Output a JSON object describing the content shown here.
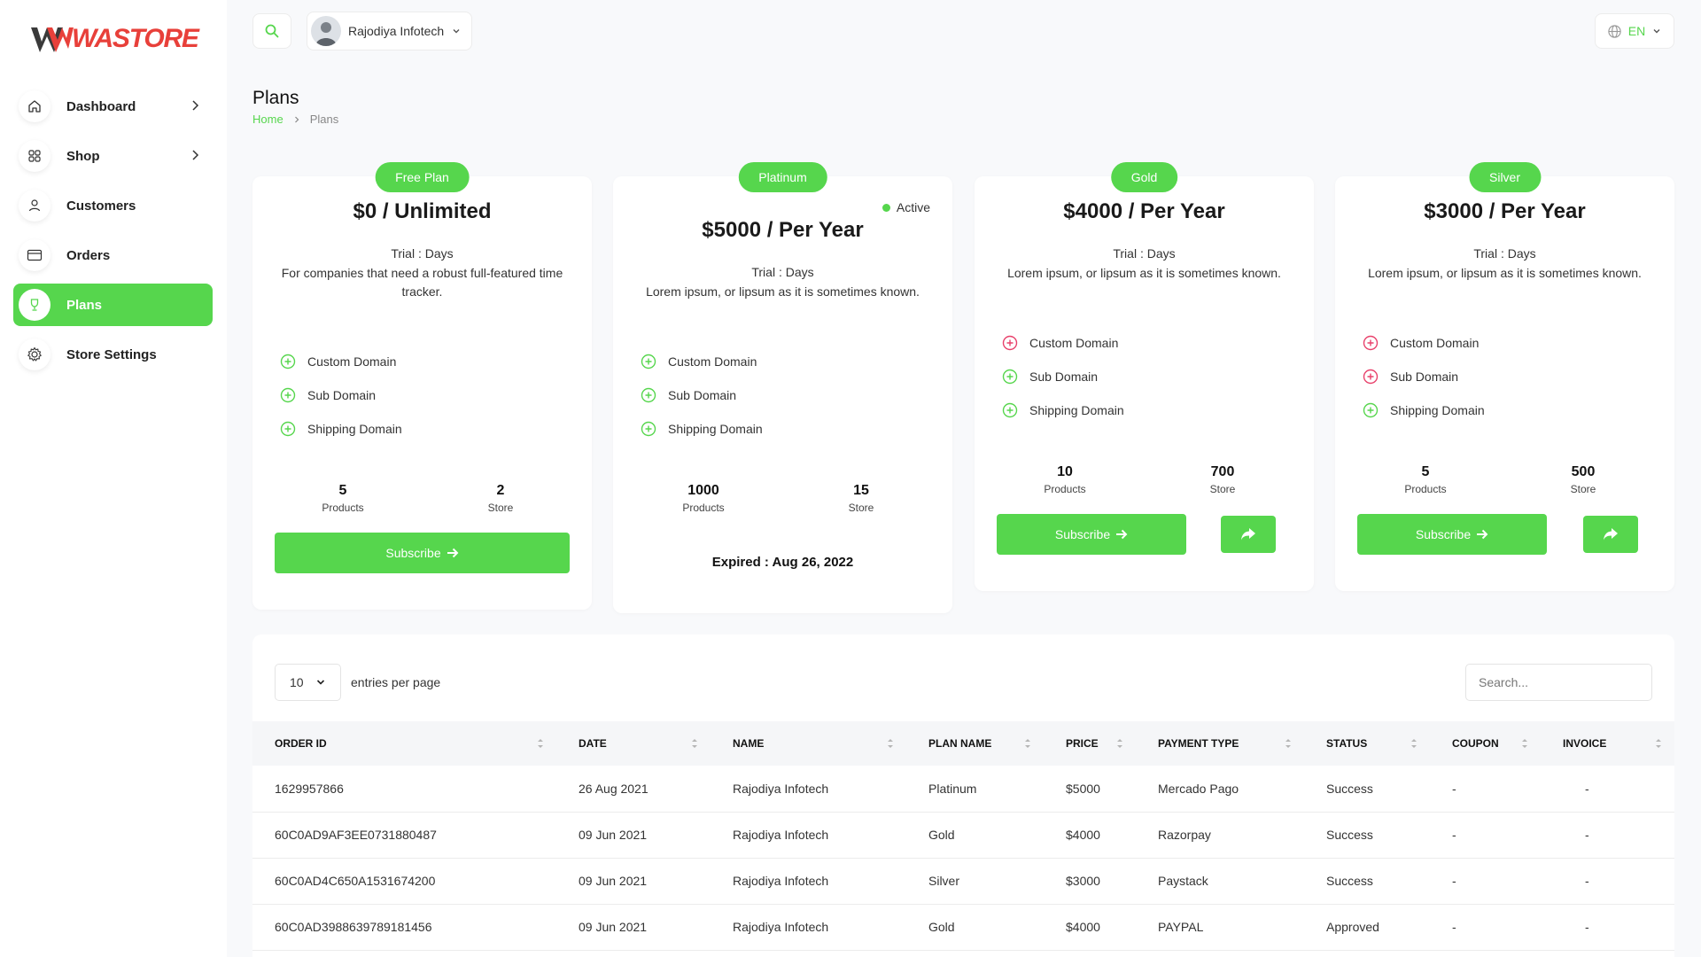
{
  "app": {
    "logo_text": "WASTORE"
  },
  "sidebar": {
    "items": [
      {
        "label": "Dashboard",
        "icon": "home-icon",
        "has_chevron": true
      },
      {
        "label": "Shop",
        "icon": "grid-icon",
        "has_chevron": true
      },
      {
        "label": "Customers",
        "icon": "user-icon",
        "has_chevron": false
      },
      {
        "label": "Orders",
        "icon": "card-icon",
        "has_chevron": false
      },
      {
        "label": "Plans",
        "icon": "trophy-icon",
        "has_chevron": false,
        "active": true
      },
      {
        "label": "Store Settings",
        "icon": "gear-icon",
        "has_chevron": false
      }
    ]
  },
  "topbar": {
    "user_name": "Rajodiya Infotech",
    "language": "EN"
  },
  "header": {
    "title": "Plans",
    "breadcrumb_home": "Home",
    "breadcrumb_current": "Plans"
  },
  "plans": [
    {
      "badge": "Free Plan",
      "price": "$0 / Unlimited",
      "trial": "Trial : Days",
      "description": "For companies that need a robust full-featured time tracker.",
      "features": [
        {
          "label": "Custom Domain",
          "enabled": true
        },
        {
          "label": "Sub Domain",
          "enabled": true
        },
        {
          "label": "Shipping Domain",
          "enabled": true
        }
      ],
      "products": "5",
      "products_label": "Products",
      "store": "2",
      "store_label": "Store",
      "subscribe_label": "Subscribe"
    },
    {
      "badge": "Platinum",
      "active_label": "Active",
      "price": "$5000 / Per Year",
      "trial": "Trial : Days",
      "description": "Lorem ipsum, or lipsum as it is sometimes known.",
      "features": [
        {
          "label": "Custom Domain",
          "enabled": true
        },
        {
          "label": "Sub Domain",
          "enabled": true
        },
        {
          "label": "Shipping Domain",
          "enabled": true
        }
      ],
      "products": "1000",
      "products_label": "Products",
      "store": "15",
      "store_label": "Store",
      "expired": "Expired : Aug 26, 2022"
    },
    {
      "badge": "Gold",
      "price": "$4000 / Per Year",
      "trial": "Trial : Days",
      "description": "Lorem ipsum, or lipsum as it is sometimes known.",
      "features": [
        {
          "label": "Custom Domain",
          "enabled": false
        },
        {
          "label": "Sub Domain",
          "enabled": true
        },
        {
          "label": "Shipping Domain",
          "enabled": true
        }
      ],
      "products": "10",
      "products_label": "Products",
      "store": "700",
      "store_label": "Store",
      "subscribe_label": "Subscribe"
    },
    {
      "badge": "Silver",
      "price": "$3000 / Per Year",
      "trial": "Trial : Days",
      "description": "Lorem ipsum, or lipsum as it is sometimes known.",
      "features": [
        {
          "label": "Custom Domain",
          "enabled": false
        },
        {
          "label": "Sub Domain",
          "enabled": false
        },
        {
          "label": "Shipping Domain",
          "enabled": true
        }
      ],
      "products": "5",
      "products_label": "Products",
      "store": "500",
      "store_label": "Store",
      "subscribe_label": "Subscribe"
    }
  ],
  "table": {
    "entries_value": "10",
    "entries_label": "entries per page",
    "search_placeholder": "Search...",
    "columns": [
      "ORDER ID",
      "DATE",
      "NAME",
      "PLAN NAME",
      "PRICE",
      "PAYMENT TYPE",
      "STATUS",
      "COUPON",
      "INVOICE"
    ],
    "rows": [
      [
        "1629957866",
        "26 Aug 2021",
        "Rajodiya Infotech",
        "Platinum",
        "$5000",
        "Mercado Pago",
        "Success",
        "-",
        "-"
      ],
      [
        "60C0AD9AF3EE0731880487",
        "09 Jun 2021",
        "Rajodiya Infotech",
        "Gold",
        "$4000",
        "Razorpay",
        "Success",
        "-",
        "-"
      ],
      [
        "60C0AD4C650A1531674200",
        "09 Jun 2021",
        "Rajodiya Infotech",
        "Silver",
        "$3000",
        "Paystack",
        "Success",
        "-",
        "-"
      ],
      [
        "60C0AD3988639789181456",
        "09 Jun 2021",
        "Rajodiya Infotech",
        "Gold",
        "$4000",
        "PAYPAL",
        "Approved",
        "-",
        "-"
      ]
    ]
  },
  "colors": {
    "accent": "#56d64d",
    "logo": "#e8403a",
    "disabled_feature": "#e8416b"
  }
}
